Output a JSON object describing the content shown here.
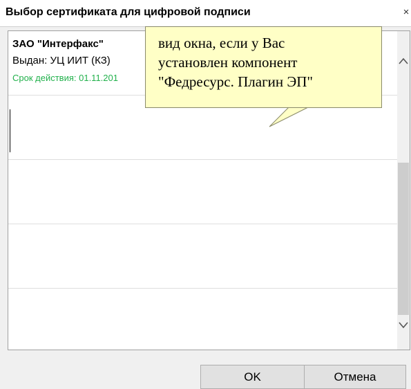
{
  "dialog": {
    "title": "Выбор сертификата для цифровой подписи",
    "close_glyph": "×"
  },
  "certificates": [
    {
      "name": "ЗАО \"Интерфакс\"",
      "issuer": "Выдан: УЦ ИИТ (КЗ)",
      "validity": "Срок действия: 01.11.201"
    }
  ],
  "callout": {
    "lines": [
      "вид окна, если у Вас",
      "установлен компонент",
      "\"Федресурс. Плагин ЭП\""
    ]
  },
  "scrollbar": {
    "up_glyph": "^",
    "down_glyph": "v"
  },
  "buttons": {
    "ok_label": "OK",
    "cancel_label": "Отмена"
  },
  "colors": {
    "validity_text": "#22b14c",
    "callout_fill": "#ffffc6"
  }
}
